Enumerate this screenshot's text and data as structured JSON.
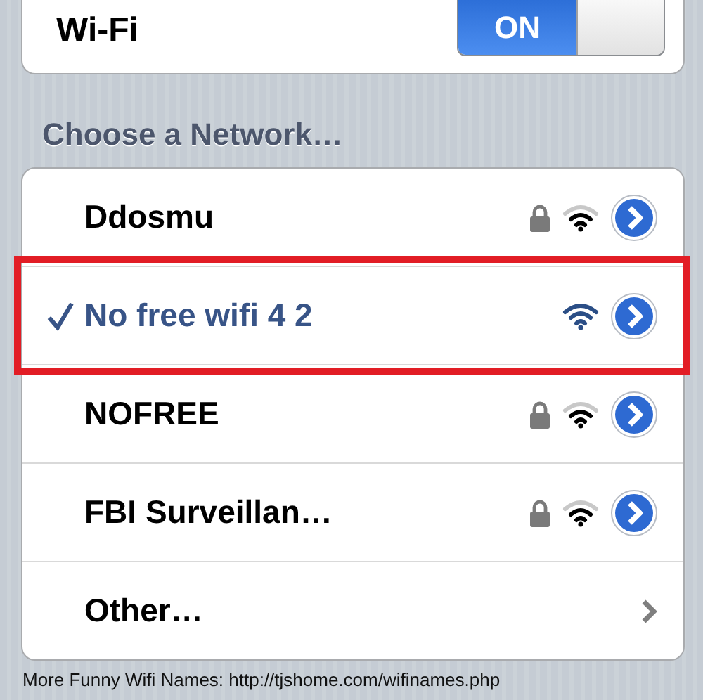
{
  "wifi": {
    "label": "Wi-Fi",
    "on": true,
    "on_text": "ON"
  },
  "section_title": "Choose a Network…",
  "networks": [
    {
      "kind": "network",
      "name": "Ddosmu",
      "selected": false,
      "secured": true,
      "annotated": false
    },
    {
      "kind": "network",
      "name": "No free wifi 4 2",
      "selected": true,
      "secured": false,
      "annotated": true
    },
    {
      "kind": "network",
      "name": "NOFREE",
      "selected": false,
      "secured": true,
      "annotated": false
    },
    {
      "kind": "network",
      "name": "FBI Surveillan…",
      "selected": false,
      "secured": true,
      "annotated": false
    },
    {
      "kind": "other",
      "name": "Other…",
      "selected": false
    }
  ],
  "caption": "More Funny Wifi Names: http://tjshome.com/wifinames.php"
}
